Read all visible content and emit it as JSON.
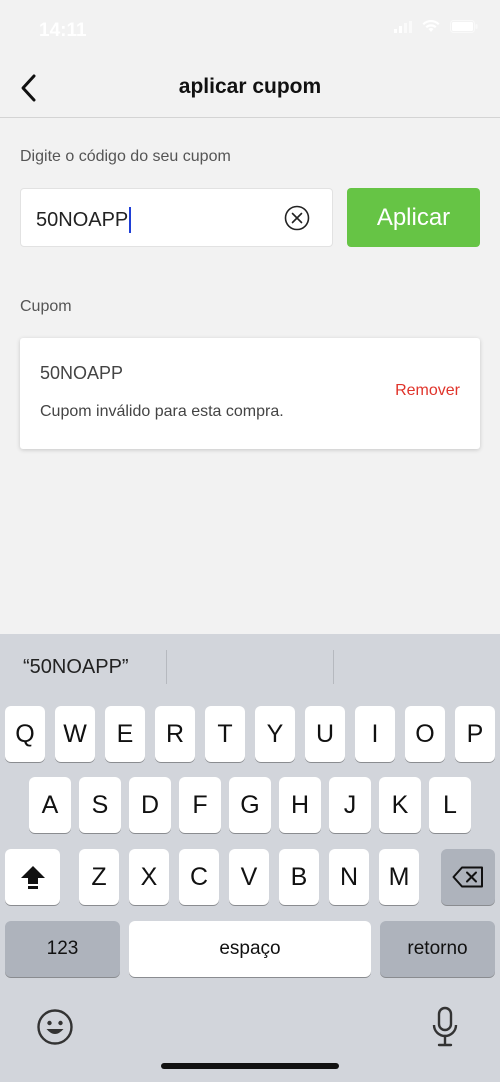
{
  "status_bar": {
    "time": "14:11"
  },
  "nav": {
    "title": "aplicar cupom",
    "back_icon": "chevron-left-icon"
  },
  "coupon_form": {
    "label": "Digite o código do seu cupom",
    "input_value": "50NOAPP",
    "clear_icon": "clear-circle-icon",
    "apply_label": "Aplicar"
  },
  "coupon_section": {
    "label": "Cupom",
    "code": "50NOAPP",
    "message": "Cupom inválido para esta compra.",
    "remove_label": "Remover"
  },
  "keyboard": {
    "suggestion": "“50NOAPP”",
    "row1": [
      "Q",
      "W",
      "E",
      "R",
      "T",
      "Y",
      "U",
      "I",
      "O",
      "P"
    ],
    "row2": [
      "A",
      "S",
      "D",
      "F",
      "G",
      "H",
      "J",
      "K",
      "L"
    ],
    "row3": [
      "Z",
      "X",
      "C",
      "V",
      "B",
      "N",
      "M"
    ],
    "numbers_label": "123",
    "space_label": "espaço",
    "return_label": "retorno"
  },
  "colors": {
    "accent_green": "#66c445",
    "remove_red": "#e0342b",
    "caret_blue": "#1f3fd6",
    "background": "#f2f2f2",
    "keyboard_bg": "#d2d5db"
  }
}
